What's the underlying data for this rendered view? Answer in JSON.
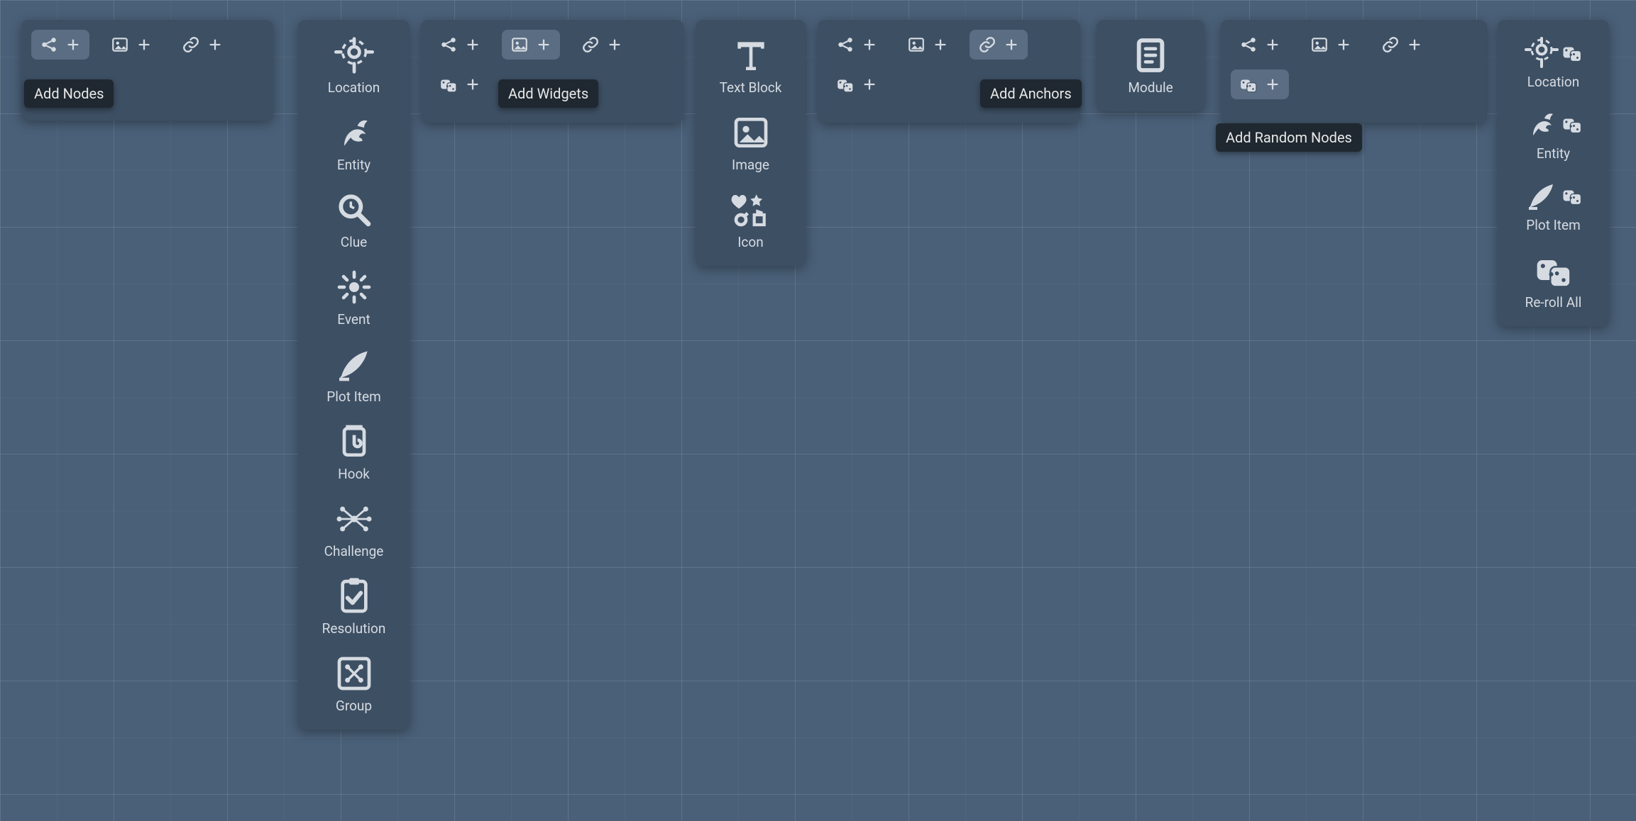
{
  "tooltips": {
    "add_nodes": "Add Nodes",
    "add_widgets": "Add Widgets",
    "add_anchors": "Add Anchors",
    "add_random_nodes": "Add Random Nodes"
  },
  "node_menu": {
    "location": "Location",
    "entity": "Entity",
    "clue": "Clue",
    "event": "Event",
    "plot_item": "Plot Item",
    "hook": "Hook",
    "challenge": "Challenge",
    "resolution": "Resolution",
    "group": "Group"
  },
  "widget_menu": {
    "text_block": "Text Block",
    "image": "Image",
    "icon": "Icon"
  },
  "anchor_menu": {
    "module": "Module"
  },
  "random_menu": {
    "location": "Location",
    "entity": "Entity",
    "plot_item": "Plot Item",
    "reroll_all": "Re-roll All"
  }
}
